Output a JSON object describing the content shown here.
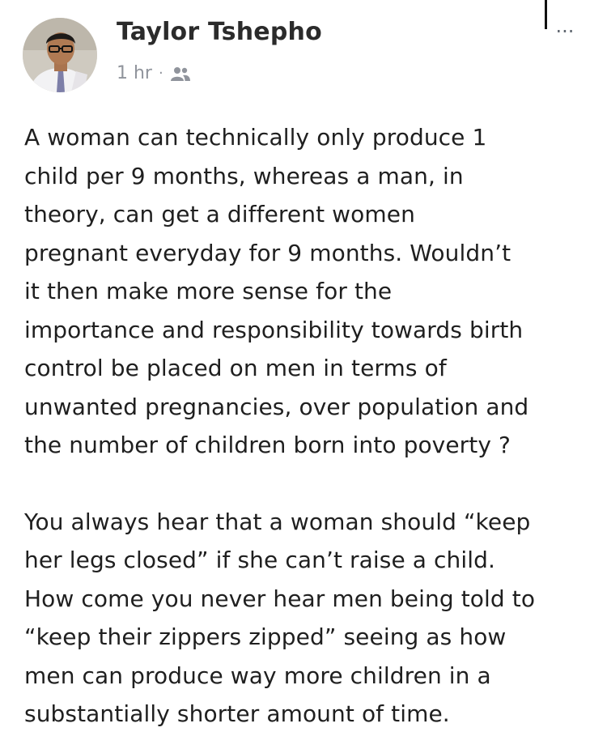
{
  "post": {
    "author_name": "Taylor Tshepho",
    "timestamp": "1 hr",
    "separator": "·",
    "audience_icon": "friends-icon",
    "more_icon": "ellipsis-icon",
    "more_label": "...",
    "paragraph_1": "A woman can technically only produce 1\nchild per 9 months, whereas a man, in\ntheory, can get a different women\npregnant everyday for 9 months. Wouldn’t\nit then make more sense for the\nimportance and responsibility towards birth\ncontrol be placed on men in terms of\nunwanted pregnancies, over population and\nthe number of children born into poverty ?",
    "paragraph_2": "You always hear that a woman should “keep\nher legs closed” if she can’t raise a child.\nHow come you never hear men being told to\n“keep their zippers zipped” seeing as how\nmen can produce way more children in a\nsubstantially shorter amount of time."
  }
}
